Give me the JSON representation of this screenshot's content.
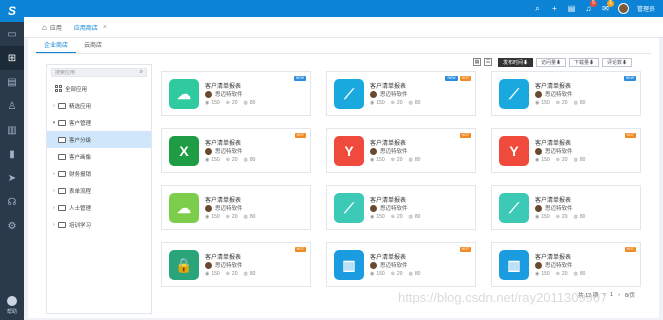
{
  "rail": {
    "logo": "S",
    "items": [
      "desktop-icon",
      "apps-icon",
      "document-icon",
      "person-icon",
      "document2-icon",
      "chart-icon",
      "send-icon",
      "headset-icon",
      "settings-icon"
    ],
    "help_label": "帮助"
  },
  "topbar": {
    "badges": {
      "bell": "5",
      "chat": "1"
    },
    "username": "管理员"
  },
  "tabs": [
    {
      "label": "应用"
    },
    {
      "label": "应用商店"
    }
  ],
  "subtabs": [
    "企业商店",
    "云商店"
  ],
  "search": {
    "placeholder": "搜索应用"
  },
  "tree": [
    {
      "label": "全部应用",
      "kind": "root"
    },
    {
      "label": "精选应用",
      "kind": "folder",
      "expanded": false
    },
    {
      "label": "客户管理",
      "kind": "folder",
      "expanded": true
    },
    {
      "label": "客户分级",
      "kind": "child",
      "selected": true
    },
    {
      "label": "客户画像",
      "kind": "child"
    },
    {
      "label": "财务报销",
      "kind": "folder",
      "expanded": false
    },
    {
      "label": "表单流程",
      "kind": "folder",
      "expanded": false
    },
    {
      "label": "人士管理",
      "kind": "folder",
      "expanded": false
    },
    {
      "label": "培训学习",
      "kind": "folder",
      "expanded": false
    }
  ],
  "sort": [
    "发布时间⬇",
    "访问量⬇",
    "下载量⬇",
    "评论数⬇"
  ],
  "colors": {
    "accent": "#0d83d6",
    "new_tag": "#2d8ddd",
    "hot_tag": "#f08a24"
  },
  "cards": [
    {
      "title": "客户清单报表",
      "vendor": "思迈特软件",
      "views": "150",
      "downloads": "20",
      "comments": "80",
      "icon": "cloud-icon",
      "color": "#2fcaa0",
      "tags": [
        "NEW"
      ]
    },
    {
      "title": "客户清单报表",
      "vendor": "思迈特软件",
      "views": "150",
      "downloads": "20",
      "comments": "80",
      "icon": "slash-icon",
      "color": "#19a9df",
      "tags": [
        "NEW",
        "HOT"
      ]
    },
    {
      "title": "客户清单报表",
      "vendor": "思迈特软件",
      "views": "150",
      "downloads": "20",
      "comments": "80",
      "icon": "slash-icon",
      "color": "#19a9df",
      "tags": [
        "NEW"
      ]
    },
    {
      "title": "客户清单报表",
      "vendor": "思迈特软件",
      "views": "150",
      "downloads": "20",
      "comments": "80",
      "icon": "excel-icon",
      "color": "#1f9d45",
      "tags": [
        "HOT"
      ]
    },
    {
      "title": "客户清单报表",
      "vendor": "思迈特软件",
      "views": "150",
      "downloads": "20",
      "comments": "80",
      "icon": "y-icon",
      "color": "#f04a3c",
      "tags": [
        "HOT"
      ]
    },
    {
      "title": "客户清单报表",
      "vendor": "思迈特软件",
      "views": "150",
      "downloads": "20",
      "comments": "80",
      "icon": "y-icon",
      "color": "#f04a3c",
      "tags": [
        "HOT"
      ]
    },
    {
      "title": "客户清单报表",
      "vendor": "思迈特软件",
      "views": "150",
      "downloads": "20",
      "comments": "80",
      "icon": "cloud-icon",
      "color": "#7ccd4b",
      "tags": []
    },
    {
      "title": "客户清单报表",
      "vendor": "思迈特软件",
      "views": "150",
      "downloads": "20",
      "comments": "80",
      "icon": "slash-icon",
      "color": "#3cc9b5",
      "tags": []
    },
    {
      "title": "客户清单报表",
      "vendor": "思迈特软件",
      "views": "150",
      "downloads": "20",
      "comments": "80",
      "icon": "slash-icon",
      "color": "#3cc9b5",
      "tags": []
    },
    {
      "title": "客户清单报表",
      "vendor": "思迈特软件",
      "views": "150",
      "downloads": "20",
      "comments": "80",
      "icon": "lock-icon",
      "color": "#2aa57a",
      "tags": [
        "HOT"
      ]
    },
    {
      "title": "客户清单报表",
      "vendor": "思迈特软件",
      "views": "150",
      "downloads": "20",
      "comments": "80",
      "icon": "bank-icon",
      "color": "#1b9be0",
      "tags": [
        "HOT"
      ]
    },
    {
      "title": "客户清单报表",
      "vendor": "思迈特软件",
      "views": "150",
      "downloads": "20",
      "comments": "80",
      "icon": "bank-icon",
      "color": "#1b9be0",
      "tags": [
        "HOT"
      ]
    }
  ],
  "pager": {
    "total": "共 12 项",
    "page": "1",
    "size": "8/页"
  },
  "watermark": "https://blog.csdn.net/ray2011309907"
}
